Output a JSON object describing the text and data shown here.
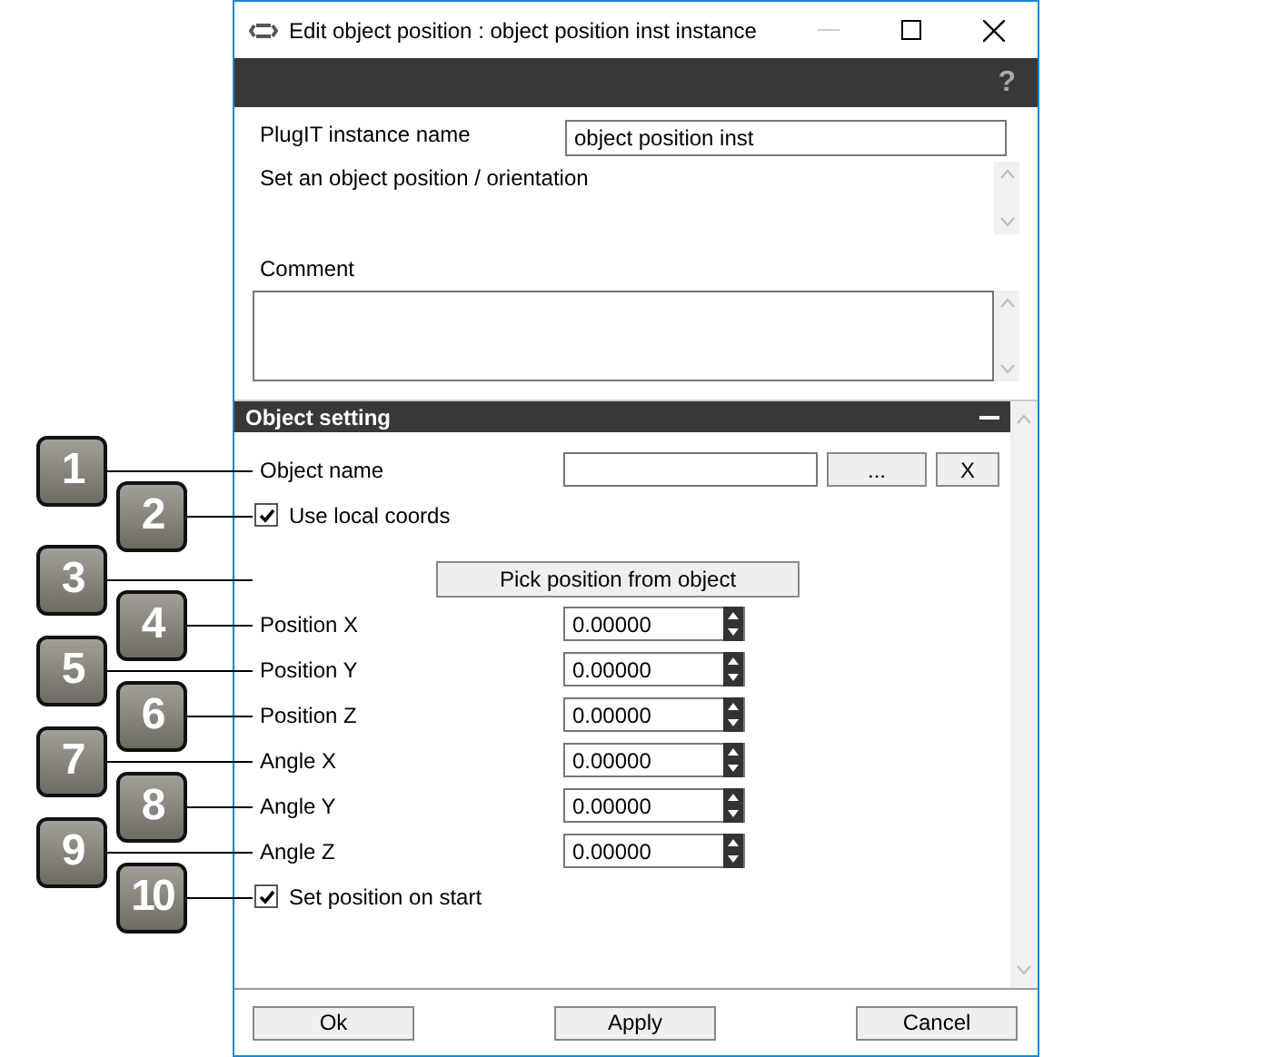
{
  "window": {
    "title": "Edit object position : object position inst instance"
  },
  "toolbar": {
    "help": "?"
  },
  "instance_name": {
    "label": "PlugIT instance name",
    "value": "object position inst"
  },
  "description": "Set an object position / orientation",
  "comment": {
    "label": "Comment"
  },
  "section": {
    "title": "Object setting",
    "expanded": true
  },
  "rows": [
    {
      "kind": "text_field",
      "callout": "1",
      "label": "Object name",
      "buttons": [
        "...",
        "X"
      ]
    },
    {
      "kind": "checkbox",
      "callout": "2",
      "label": "Use local coords",
      "checked": true
    },
    {
      "kind": "button",
      "callout": "3",
      "label": "Pick position from object"
    },
    {
      "kind": "spin",
      "callout": "4",
      "label": "Position X",
      "value": "0.00000"
    },
    {
      "kind": "spin",
      "callout": "5",
      "label": "Position Y",
      "value": "0.00000"
    },
    {
      "kind": "spin",
      "callout": "6",
      "label": "Position Z",
      "value": "0.00000"
    },
    {
      "kind": "spin",
      "callout": "7",
      "label": "Angle X",
      "value": "0.00000"
    },
    {
      "kind": "spin",
      "callout": "8",
      "label": "Angle Y",
      "value": "0.00000"
    },
    {
      "kind": "spin",
      "callout": "9",
      "label": "Angle Z",
      "value": "0.00000"
    },
    {
      "kind": "checkbox",
      "callout": "10",
      "label": "Set position on start",
      "checked": true
    }
  ],
  "footer_buttons": [
    "Ok",
    "Apply",
    "Cancel"
  ]
}
